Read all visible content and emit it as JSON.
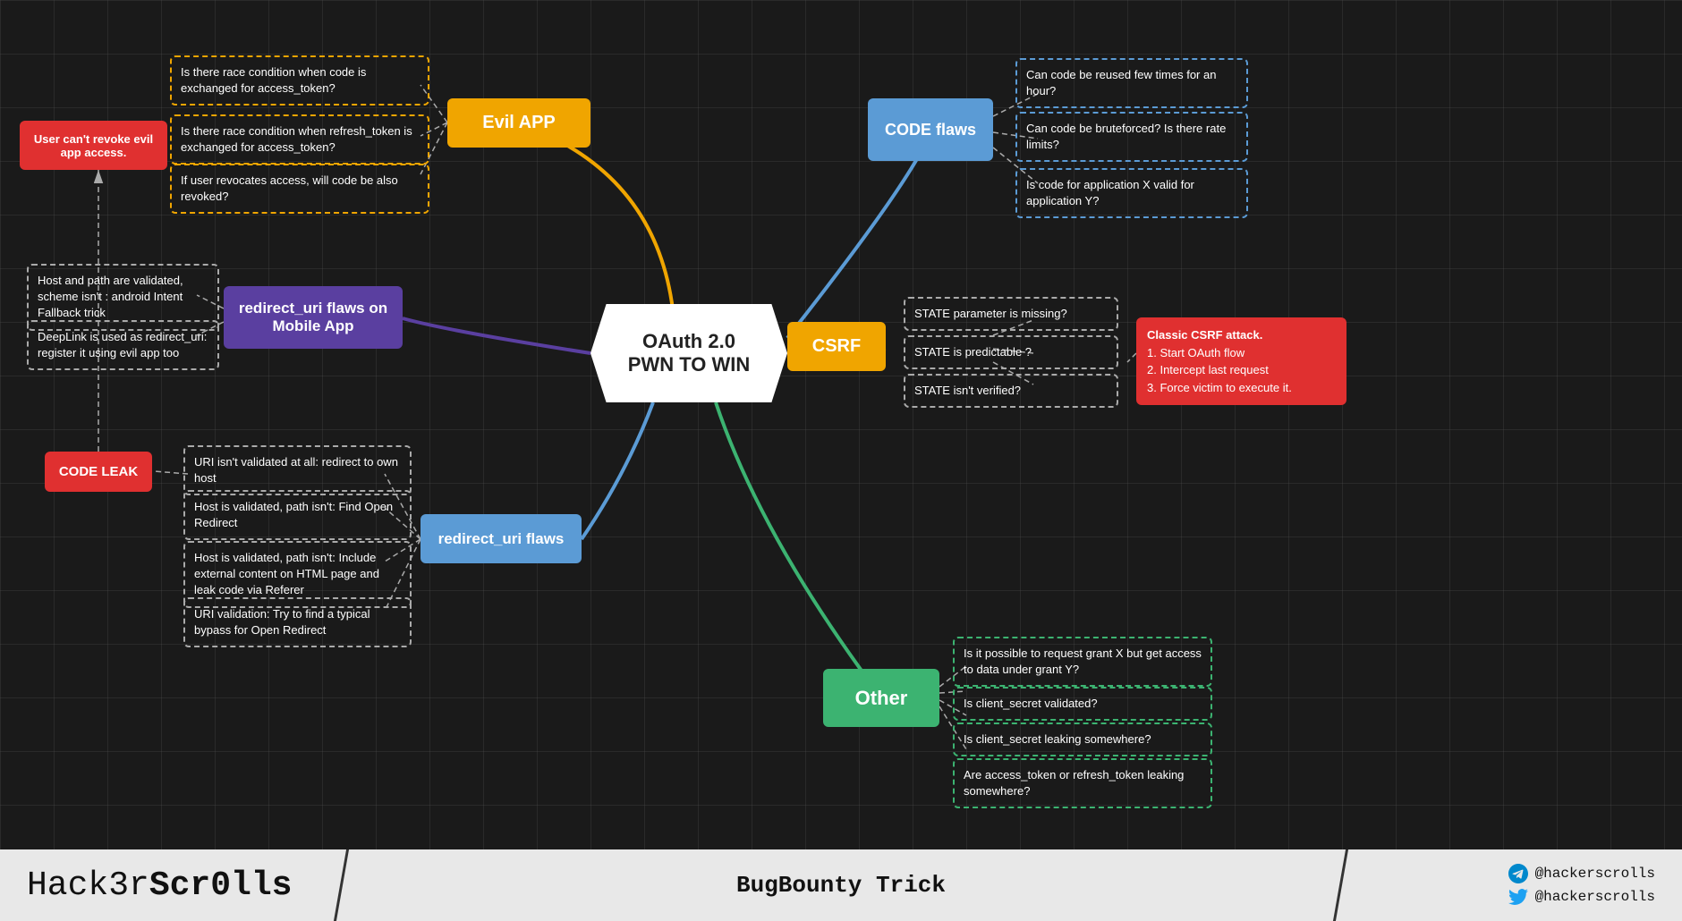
{
  "center": {
    "line1": "OAuth 2.0",
    "line2": "PWN TO WIN"
  },
  "nodes": {
    "evil_app": "Evil APP",
    "code_flaws": "CODE flaws",
    "csrf": "CSRF",
    "redirect_uri_mobile": "redirect_uri flaws on Mobile App",
    "redirect_uri": "redirect_uri flaws",
    "other": "Other",
    "code_leak": "CODE LEAK",
    "user_cant_revoke": "User can't revoke evil app access."
  },
  "info_boxes": {
    "evil_q1": "Is there race condition when code is exchanged for access_token?",
    "evil_q2": "Is there race condition when refresh_token is exchanged for access_token?",
    "evil_q3": "If user revocates access, will code be also revoked?",
    "code_flaws_q1": "Can code be reused few times for an hour?",
    "code_flaws_q2": "Can code be bruteforced? Is there rate limits?",
    "code_flaws_q3": "Is code for application X valid for application Y?",
    "csrf_q1": "STATE parameter is missing?",
    "csrf_q2": "STATE is predictable ?",
    "csrf_q3": "STATE isn't verified?",
    "classic_csrf": "Classic CSRF attack.\n1. Start OAuth flow\n2. Intercept last request\n3. Force victim to execute it.",
    "mobile_q1": "Host and path are validated, scheme isn't : android Intent Fallback trick",
    "mobile_q2": "DeepLink is used as redirect_uri: register it using evil app too",
    "redirect_q1": "URI isn't validated at all: redirect to own host",
    "redirect_q2": "Host is validated, path isn't: Find Open Redirect",
    "redirect_q3": "Host is validated, path isn't: Include external content on HTML page and leak code via Referer",
    "redirect_q4": "URI validation: Try to find a typical bypass for Open Redirect",
    "other_q1": "Is it possible to request grant X but get access to data under grant Y?",
    "other_q2": "Is client_secret validated?",
    "other_q3": "Is client_secret leaking somewhere?",
    "other_q4": "Are access_token or refresh_token leaking somewhere?"
  },
  "footer": {
    "brand": "Hack3rScr0lls",
    "brand_bold": "Scr0lls",
    "subtitle": "BugBounty Trick",
    "telegram": "@hackerscrolls",
    "twitter": "@hackerscrolls"
  },
  "colors": {
    "gold": "#f0a500",
    "blue": "#5b9bd5",
    "purple": "#5a3fa0",
    "green": "#3cb371",
    "red": "#e03030",
    "white": "#ffffff",
    "dark_bg": "#1c1c1c"
  }
}
